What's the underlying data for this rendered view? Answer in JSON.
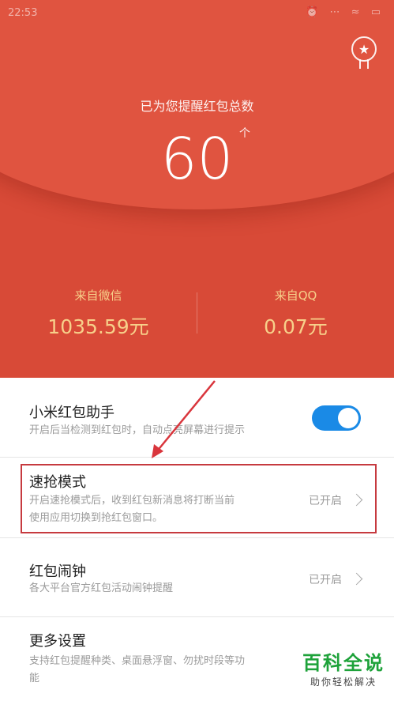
{
  "status_bar": {
    "time": "22:53",
    "icons": "⏰ ⋯ ≈ ▭"
  },
  "hero": {
    "total_label": "已为您提醒红包总数",
    "total_value": "60",
    "total_unit": "个",
    "wechat": {
      "label": "来自微信",
      "value": "1035.59元"
    },
    "qq": {
      "label": "来自QQ",
      "value": "0.07元"
    }
  },
  "settings": {
    "assistant": {
      "title": "小米红包助手",
      "subtitle": "开启后当检测到红包时，自动点亮屏幕进行提示",
      "enabled": true
    },
    "quick_grab": {
      "title": "速抢模式",
      "subtitle_line1": "开启速抢模式后，收到红包新消息将打断当前",
      "subtitle_line2": "使用应用切换到抢红包窗口。",
      "value": "已开启"
    },
    "alarm": {
      "title": "红包闹钟",
      "subtitle": "各大平台官方红包活动闹钟提醒",
      "value": "已开启"
    },
    "more": {
      "title": "更多设置",
      "subtitle_line1": "支持红包提醒种类、桌面悬浮窗、勿扰时段等功",
      "subtitle_line2": "能"
    }
  },
  "watermark": {
    "title": "百科全说",
    "subtitle": "助你轻松解决"
  },
  "colors": {
    "hero_red": "#d84a37",
    "gold_text": "#f7d08a",
    "toggle_blue": "#1a8ae6",
    "highlight_red": "#c63a3f",
    "watermark_green": "#1ea23a"
  }
}
